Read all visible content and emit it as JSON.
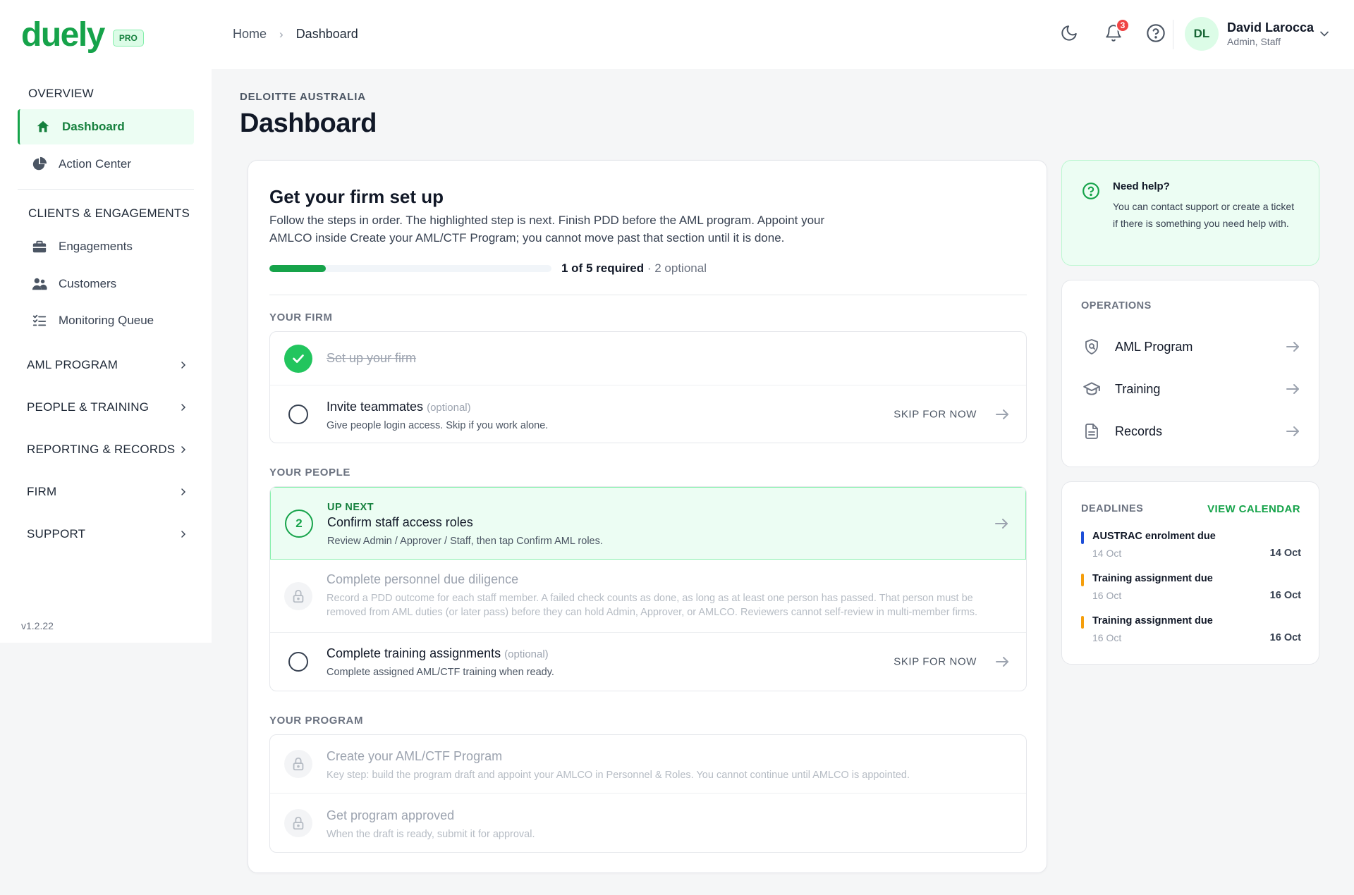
{
  "brand": {
    "name": "duely",
    "badge": "PRO"
  },
  "breadcrumb": {
    "home": "Home",
    "current": "Dashboard"
  },
  "header": {
    "notification_count": "3"
  },
  "user": {
    "initials": "DL",
    "name": "David Larocca",
    "role": "Admin, Staff"
  },
  "sidebar": {
    "overview_label": "OVERVIEW",
    "dashboard": "Dashboard",
    "action_center": "Action Center",
    "clients_label": "CLIENTS & ENGAGEMENTS",
    "engagements": "Engagements",
    "customers": "Customers",
    "monitoring_queue": "Monitoring Queue",
    "groups": [
      "AML PROGRAM",
      "PEOPLE & TRAINING",
      "REPORTING & RECORDS",
      "FIRM",
      "SUPPORT"
    ],
    "version": "v1.2.22"
  },
  "page": {
    "org": "DELOITTE AUSTRALIA",
    "title": "Dashboard"
  },
  "setup": {
    "title": "Get your firm set up",
    "description": "Follow the steps in order. The highlighted step is next. Finish PDD before the AML program. Appoint your AMLCO inside Create your AML/CTF Program; you cannot move past that section until it is done.",
    "progress_fraction": 0.2,
    "progress_required": "1 of 5 required",
    "progress_optional": " · 2 optional",
    "groups": {
      "firm": "YOUR FIRM",
      "people": "YOUR PEOPLE",
      "program": "YOUR PROGRAM"
    },
    "steps": {
      "setup_firm": {
        "title": "Set up your firm"
      },
      "invite": {
        "title": "Invite teammates",
        "optional": "(optional)",
        "sub": "Give people login access. Skip if you work alone.",
        "skip": "SKIP FOR NOW"
      },
      "confirm_roles": {
        "badge": "UP NEXT",
        "number": "2",
        "title": "Confirm staff access roles",
        "sub": "Review Admin / Approver / Staff, then tap Confirm AML roles."
      },
      "pdd": {
        "title": "Complete personnel due diligence",
        "sub": "Record a PDD outcome for each staff member. A failed check counts as done, as long as at least one person has passed. That person must be removed from AML duties (or later pass) before they can hold Admin, Approver, or AMLCO. Reviewers cannot self-review in multi-member firms."
      },
      "training": {
        "title": "Complete training assignments",
        "optional": "(optional)",
        "sub": "Complete assigned AML/CTF training when ready.",
        "skip": "SKIP FOR NOW"
      },
      "create_program": {
        "title": "Create your AML/CTF Program",
        "sub": "Key step: build the program draft and appoint your AMLCO in Personnel & Roles. You cannot continue until AMLCO is appointed."
      },
      "approve_program": {
        "title": "Get program approved",
        "sub": "When the draft is ready, submit it for approval."
      }
    }
  },
  "help": {
    "title": "Need help?",
    "body": "You can contact support or create a ticket if there is something you need help with."
  },
  "operations": {
    "label": "OPERATIONS",
    "items": [
      "AML Program",
      "Training",
      "Records"
    ]
  },
  "deadlines": {
    "label": "DEADLINES",
    "view_calendar": "VIEW CALENDAR",
    "items": [
      {
        "name": "AUSTRAC enrolment due",
        "sub": "14 Oct",
        "date": "14 Oct",
        "color": "#1d4ed8"
      },
      {
        "name": "Training assignment due",
        "sub": "16 Oct",
        "date": "16 Oct",
        "color": "#f59e0b"
      },
      {
        "name": "Training assignment due",
        "sub": "16 Oct",
        "date": "16 Oct",
        "color": "#f59e0b"
      }
    ]
  },
  "colors": {
    "accent": "#16a34a",
    "accent_bg": "#ecfdf3",
    "danger": "#ef4444"
  }
}
